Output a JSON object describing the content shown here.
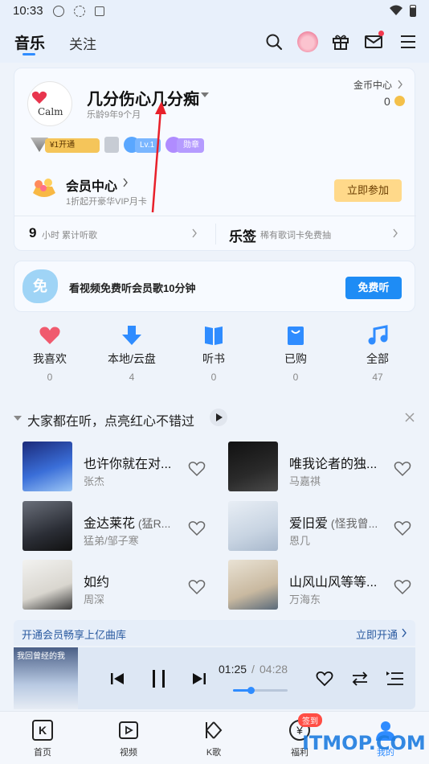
{
  "status_bar": {
    "time": "10:33"
  },
  "header": {
    "tabs": [
      {
        "label": "音乐"
      },
      {
        "label": "关注"
      }
    ]
  },
  "profile": {
    "avatar_text": "Calm",
    "username": "几分伤心几分痴",
    "music_age": "乐龄9年9个月",
    "coin_center_label": "金币中心",
    "coin_count": "0",
    "badges": {
      "vip_open": "¥1开通",
      "level": "Lv.1",
      "medal": "勋章"
    },
    "member_center": {
      "title": "会员中心",
      "subtitle": "1折起开豪华VIP月卡",
      "button": "立即参加"
    },
    "stats": {
      "hours_value": "9",
      "hours_label": "小时 累计听歌",
      "lequan_title": "乐签",
      "lequan_desc": "稀有歌词卡免费抽"
    }
  },
  "promo": {
    "icon_text": "免",
    "text": "看视频免费听会员歌10分钟",
    "button": "免费听"
  },
  "quick_nav": [
    {
      "label": "我喜欢",
      "count": "0",
      "color": "#f05a6e"
    },
    {
      "label": "本地/云盘",
      "count": "4",
      "color": "#2f8cff"
    },
    {
      "label": "听书",
      "count": "0",
      "color": "#2f8cff"
    },
    {
      "label": "已购",
      "count": "0",
      "color": "#2f8cff"
    },
    {
      "label": "全部",
      "count": "47",
      "color": "#2f8cff"
    }
  ],
  "recommend": {
    "title": "大家都在听，点亮红心不错过",
    "songs": [
      {
        "title": "也许你就在对...",
        "sub": "",
        "artist": "张杰"
      },
      {
        "title": "唯我论者的独...",
        "sub": "",
        "artist": "马嘉祺"
      },
      {
        "title": "金达莱花",
        "sub": " (猛R...",
        "artist": "猛弟/邹子寒"
      },
      {
        "title": "爱旧爱",
        "sub": " (怪我曾...",
        "artist": "恩几"
      },
      {
        "title": "如约",
        "sub": "",
        "artist": "周深"
      },
      {
        "title": "山风山风等等...",
        "sub": "",
        "artist": "万海东"
      }
    ]
  },
  "member_bar": {
    "text": "开通会员畅享上亿曲库",
    "action": "立即开通"
  },
  "player": {
    "cover_text": "我回曾经的我",
    "current_time": "01:25",
    "total_time": "04:28",
    "progress": 0.33
  },
  "bottom_nav": [
    {
      "label": "首页"
    },
    {
      "label": "视频"
    },
    {
      "label": "K歌"
    },
    {
      "label": "福利",
      "badge": "签到"
    },
    {
      "label": "我的"
    }
  ],
  "watermark": "ITMOP.COM",
  "colors": {
    "accent": "#2f8cff",
    "heart": "#f05a6e",
    "gold": "#ffd98a"
  }
}
